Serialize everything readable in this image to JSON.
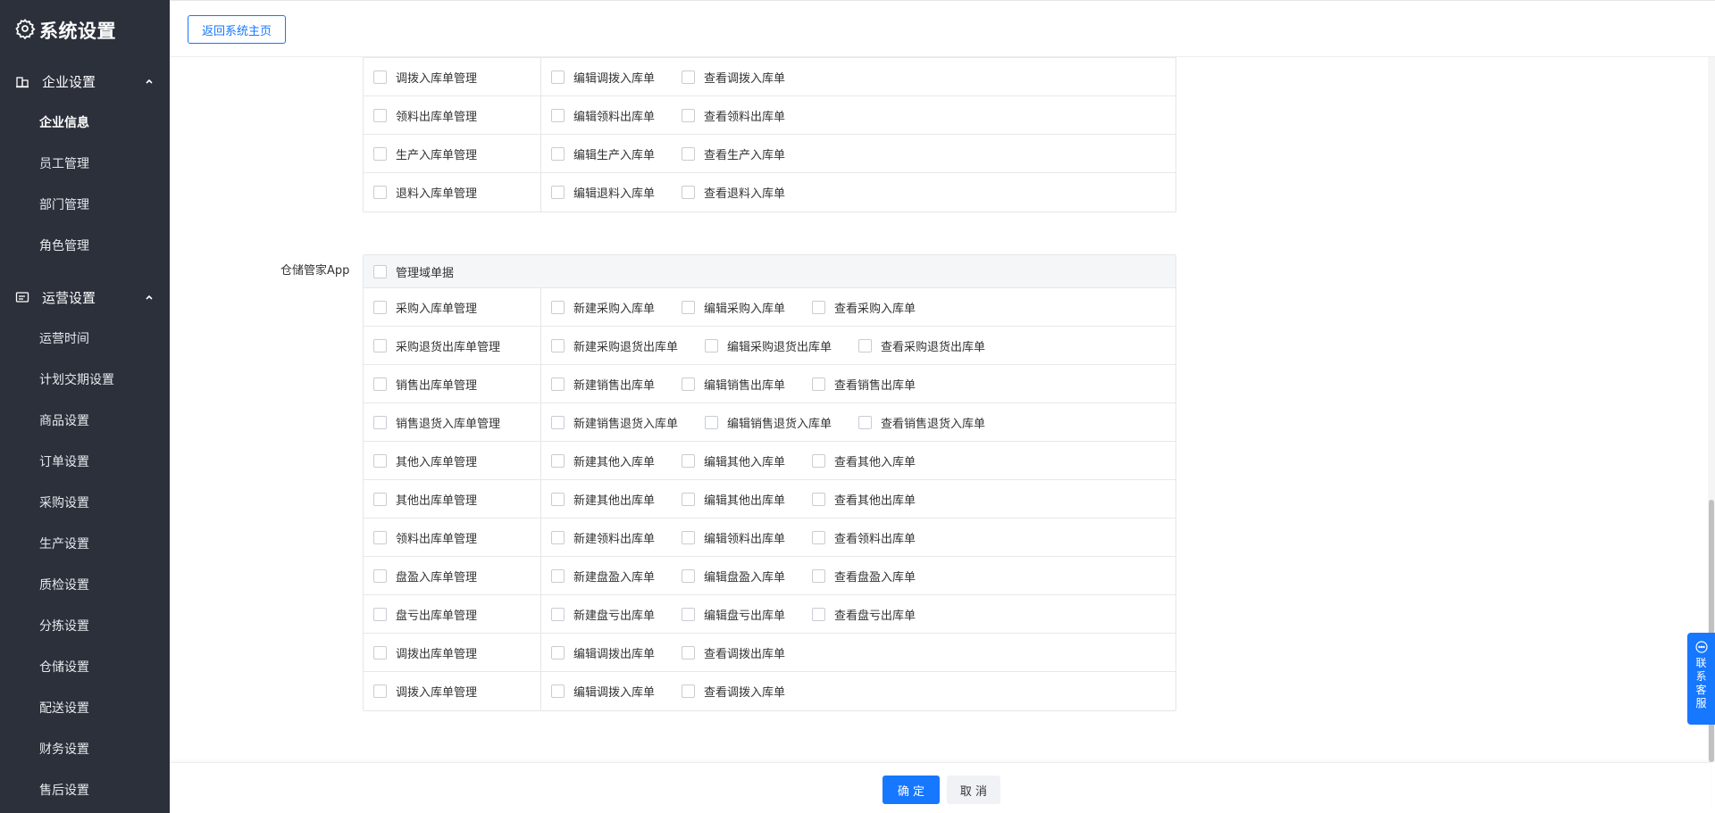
{
  "sidebar": {
    "title": "系统设置",
    "groups": [
      {
        "label": "企业设置",
        "items": [
          "企业信息",
          "员工管理",
          "部门管理",
          "角色管理"
        ]
      },
      {
        "label": "运营设置",
        "items": [
          "运营时间",
          "计划交期设置",
          "商品设置",
          "订单设置",
          "采购设置",
          "生产设置",
          "质检设置",
          "分拣设置",
          "仓储设置",
          "配送设置",
          "财务设置",
          "售后设置"
        ]
      }
    ]
  },
  "header": {
    "back_label": "返回系统主页"
  },
  "section1": {
    "rows": [
      {
        "main": "调拨入库单管理",
        "subs": [
          "编辑调拨入库单",
          "查看调拨入库单"
        ]
      },
      {
        "main": "领料出库单管理",
        "subs": [
          "编辑领料出库单",
          "查看领料出库单"
        ]
      },
      {
        "main": "生产入库单管理",
        "subs": [
          "编辑生产入库单",
          "查看生产入库单"
        ]
      },
      {
        "main": "退料入库单管理",
        "subs": [
          "编辑退料入库单",
          "查看退料入库单"
        ]
      }
    ]
  },
  "section2": {
    "label": "仓储管家App",
    "top_option": "管理域单据",
    "rows": [
      {
        "main": "采购入库单管理",
        "subs": [
          "新建采购入库单",
          "编辑采购入库单",
          "查看采购入库单"
        ]
      },
      {
        "main": "采购退货出库单管理",
        "subs": [
          "新建采购退货出库单",
          "编辑采购退货出库单",
          "查看采购退货出库单"
        ]
      },
      {
        "main": "销售出库单管理",
        "subs": [
          "新建销售出库单",
          "编辑销售出库单",
          "查看销售出库单"
        ]
      },
      {
        "main": "销售退货入库单管理",
        "subs": [
          "新建销售退货入库单",
          "编辑销售退货入库单",
          "查看销售退货入库单"
        ]
      },
      {
        "main": "其他入库单管理",
        "subs": [
          "新建其他入库单",
          "编辑其他入库单",
          "查看其他入库单"
        ]
      },
      {
        "main": "其他出库单管理",
        "subs": [
          "新建其他出库单",
          "编辑其他出库单",
          "查看其他出库单"
        ]
      },
      {
        "main": "领料出库单管理",
        "subs": [
          "新建领料出库单",
          "编辑领料出库单",
          "查看领料出库单"
        ]
      },
      {
        "main": "盘盈入库单管理",
        "subs": [
          "新建盘盈入库单",
          "编辑盘盈入库单",
          "查看盘盈入库单"
        ]
      },
      {
        "main": "盘亏出库单管理",
        "subs": [
          "新建盘亏出库单",
          "编辑盘亏出库单",
          "查看盘亏出库单"
        ]
      },
      {
        "main": "调拨出库单管理",
        "subs": [
          "编辑调拨出库单",
          "查看调拨出库单"
        ]
      },
      {
        "main": "调拨入库单管理",
        "subs": [
          "编辑调拨入库单",
          "查看调拨入库单"
        ]
      }
    ]
  },
  "footer": {
    "ok_label": "确 定",
    "cancel_label": "取 消"
  },
  "support": {
    "label": "联系客服"
  },
  "colors": {
    "sidebar_bg": "#2b303b",
    "primary": "#1677ff"
  }
}
